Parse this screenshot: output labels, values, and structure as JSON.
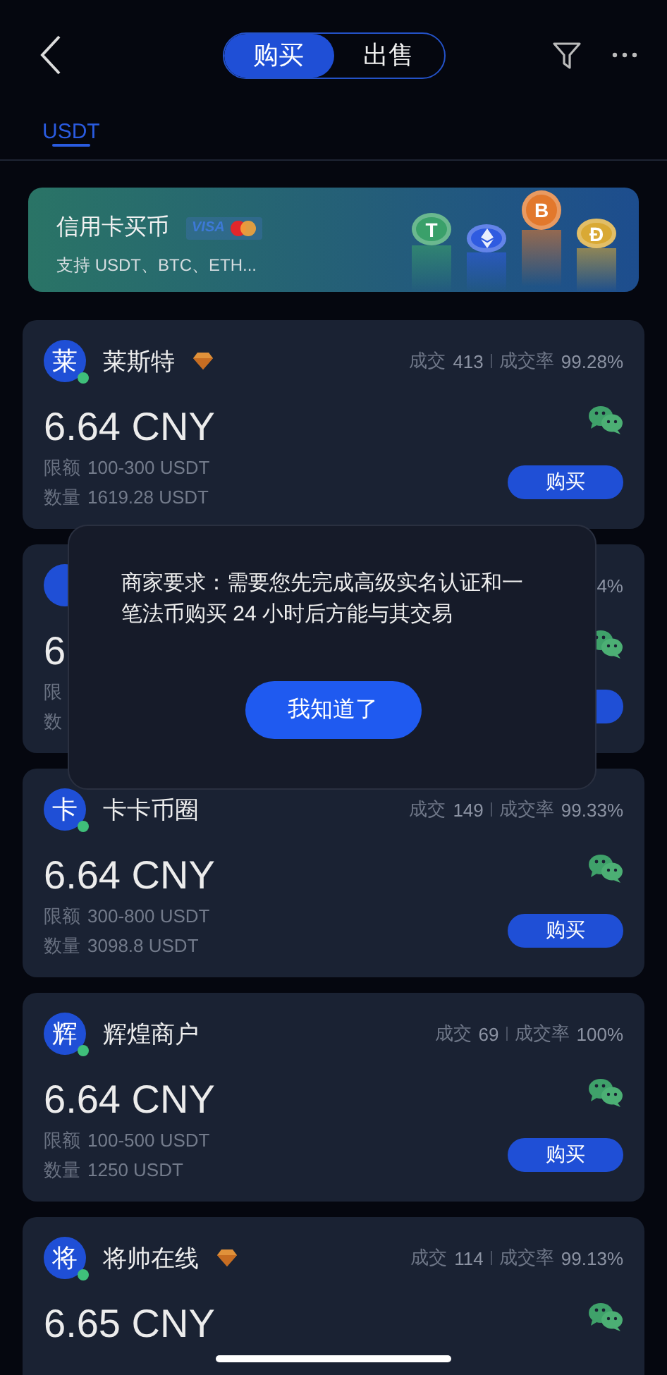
{
  "header": {
    "segments": [
      {
        "label": "购买",
        "selected": true
      },
      {
        "label": "出售",
        "selected": false
      }
    ]
  },
  "tabs": [
    {
      "label": "USDT",
      "selected": true
    }
  ],
  "banner": {
    "title": "信用卡买币",
    "card_brand": "VISA",
    "subtitle": "支持 USDT、BTC、ETH...",
    "coins": [
      {
        "kind": "letter",
        "symbol": "T",
        "color": "#3aa06a"
      },
      {
        "kind": "diamond",
        "color": "#2f5be0"
      },
      {
        "kind": "letter",
        "symbol": "B",
        "color": "#e2782c"
      },
      {
        "kind": "letter",
        "symbol": "Ð",
        "color": "#d9a935"
      }
    ]
  },
  "merchants": [
    {
      "avatar": "莱",
      "online": true,
      "name": "莱斯特",
      "diamond": true,
      "trades_label": "成交",
      "trades": "413",
      "rate_label": "成交率",
      "rate": "99.28%",
      "price": "6.64 CNY",
      "limit_label": "限额",
      "limit": "100-300 USDT",
      "amount_label": "数量",
      "amount": "1619.28 USDT",
      "wechat": true,
      "buy_button": true,
      "button": "购买"
    },
    {
      "rate": "4%",
      "price": "6",
      "limit_label": "限",
      "amount_label": "数",
      "wechat": true,
      "buy_button": true
    },
    {
      "avatar": "卡",
      "online": true,
      "name": "卡卡币圈",
      "diamond": false,
      "trades_label": "成交",
      "trades": "149",
      "rate_label": "成交率",
      "rate": "99.33%",
      "price": "6.64 CNY",
      "limit_label": "限额",
      "limit": "300-800 USDT",
      "amount_label": "数量",
      "amount": "3098.8 USDT",
      "wechat": true,
      "buy_button": true,
      "button": "购买"
    },
    {
      "avatar": "辉",
      "online": true,
      "name": "辉煌商户",
      "diamond": false,
      "trades_label": "成交",
      "trades": "69",
      "rate_label": "成交率",
      "rate": "100%",
      "price": "6.64 CNY",
      "limit_label": "限额",
      "limit": "100-500 USDT",
      "amount_label": "数量",
      "amount": "1250 USDT",
      "wechat": true,
      "buy_button": true,
      "button": "购买"
    },
    {
      "avatar": "将",
      "online": true,
      "name": "将帅在线",
      "diamond": true,
      "trades_label": "成交",
      "trades": "114",
      "rate_label": "成交率",
      "rate": "99.13%",
      "price": "6.65 CNY",
      "wechat": true
    }
  ],
  "dialog": {
    "message": "商家要求：需要您先完成高级实名认证和一笔法币购买 24 小时后方能与其交易",
    "button": "我知道了"
  }
}
